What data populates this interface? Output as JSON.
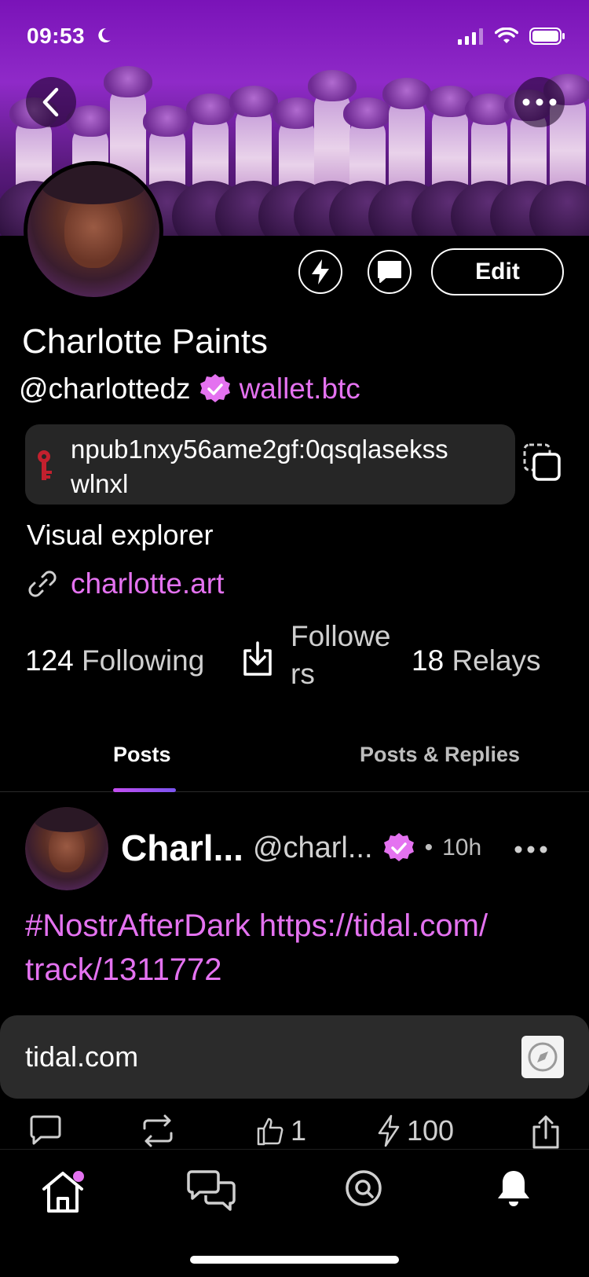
{
  "status_bar": {
    "time": "09:53"
  },
  "profile": {
    "display_name": "Charlotte Paints",
    "handle": "@charlottedz",
    "nip05": "wallet.btc",
    "npub_line1": "npub1nxy56ame2gf:0qsqlasekss",
    "npub_line2": "wlnxl",
    "bio": "Visual explorer",
    "website": "charlotte.art",
    "edit_label": "Edit"
  },
  "stats": {
    "following_count": "124",
    "following_label": "Following",
    "followers_label_1": "Followe",
    "followers_label_2": "rs",
    "relays_count": "18",
    "relays_label": "Relays"
  },
  "tabs": [
    {
      "label": "Posts",
      "active": true
    },
    {
      "label": "Posts & Replies",
      "active": false
    }
  ],
  "post": {
    "author_name": "Charl...",
    "author_handle": "@charl...",
    "dot": "•",
    "time": "10h",
    "text_line1": "#NostrAfterDark https://tidal.com/",
    "text_line2": "track/1311772",
    "link_domain": "tidal.com",
    "likes": "1",
    "zaps": "100"
  },
  "colors": {
    "accent": "#e472f0",
    "card": "#262626",
    "background": "#000000"
  },
  "icons": [
    "back-icon",
    "more-icon",
    "zap-icon",
    "message-icon",
    "verified-icon",
    "key-icon",
    "copy-icon",
    "link-icon",
    "followers-icon",
    "reply-icon",
    "repost-icon",
    "like-icon",
    "share-icon",
    "compass-icon",
    "home-icon",
    "chat-icon",
    "search-icon",
    "bell-icon"
  ]
}
